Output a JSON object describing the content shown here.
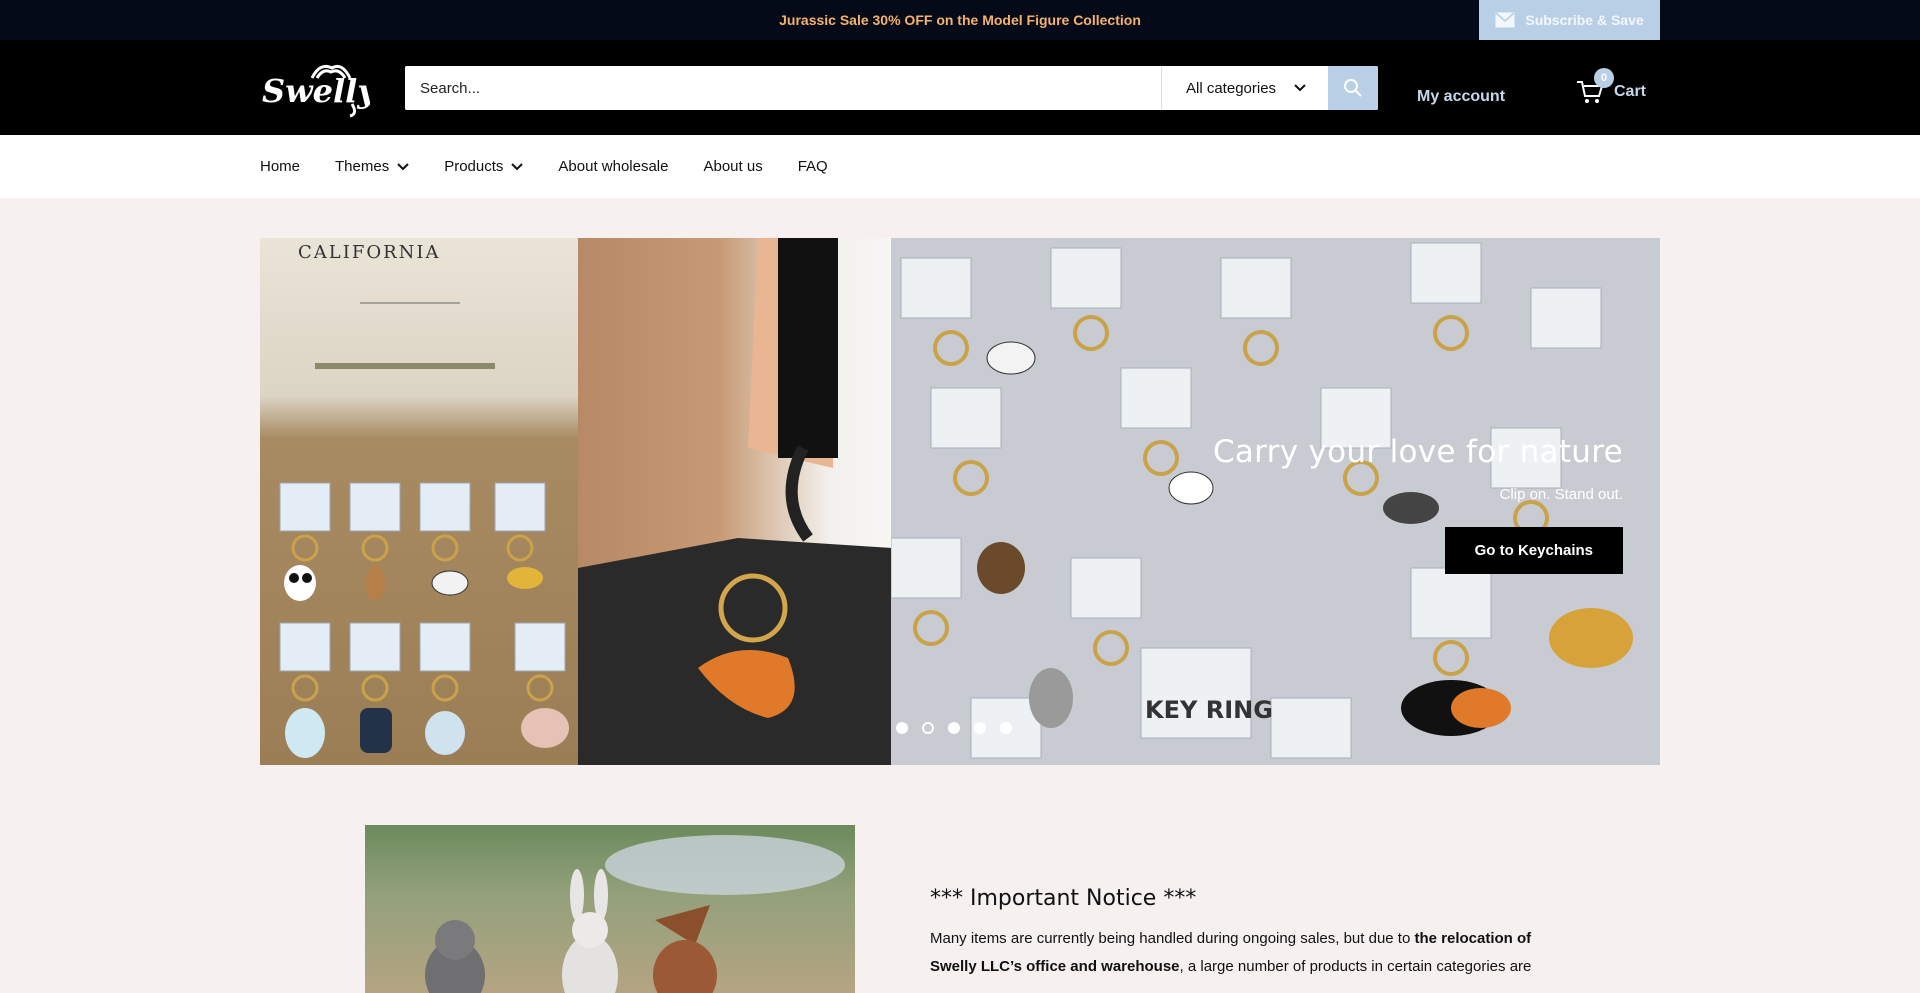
{
  "announcement": {
    "promo_text": "Jurassic Sale 30% OFF on the Model Figure Collection",
    "subscribe_label": "Subscribe & Save"
  },
  "header": {
    "logo_text": "Swelly",
    "search_placeholder": "Search...",
    "category_label": "All categories",
    "account_label": "My account",
    "cart_label": "Cart",
    "cart_count": "0"
  },
  "nav": {
    "items": [
      {
        "label": "Home",
        "has_dropdown": false
      },
      {
        "label": "Themes",
        "has_dropdown": true
      },
      {
        "label": "Products",
        "has_dropdown": true
      },
      {
        "label": "About wholesale",
        "has_dropdown": false
      },
      {
        "label": "About us",
        "has_dropdown": false
      },
      {
        "label": "FAQ",
        "has_dropdown": false
      }
    ]
  },
  "hero": {
    "sign_text": "CALIFORNIA",
    "tag_text": "KEY RING",
    "title": "Carry your love for nature",
    "subtitle": "Clip on. Stand out.",
    "button_label": "Go to Keychains",
    "slide_count": 5,
    "active_slide": 2
  },
  "notice": {
    "title": "*** Important Notice ***",
    "body_part1": "Many items are currently being handled during ongoing sales, but due to ",
    "body_bold": "the relocation of Swelly LLC’s office and warehouse",
    "body_part2": ", a large number of products in certain categories are"
  },
  "colors": {
    "topbar_bg": "#050a18",
    "promo_text": "#f5b26a",
    "accent_blue": "#b8cfe6",
    "header_bg": "#000000",
    "page_bg": "#f6f1f0"
  }
}
